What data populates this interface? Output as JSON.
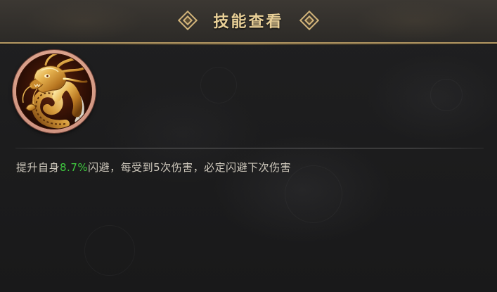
{
  "header": {
    "title": "技能查看"
  },
  "skill": {
    "icon": "golden-dragon-icon",
    "description_prefix": "提升自身",
    "description_value": "8.7%",
    "description_suffix": "闪避，每受到5次伤害，必定闪避下次伤害"
  },
  "colors": {
    "title_gold": "#e8cf97",
    "border_gold": "#b69a64",
    "highlight_green": "#3fc83f",
    "body_text": "#cfc9bd"
  }
}
